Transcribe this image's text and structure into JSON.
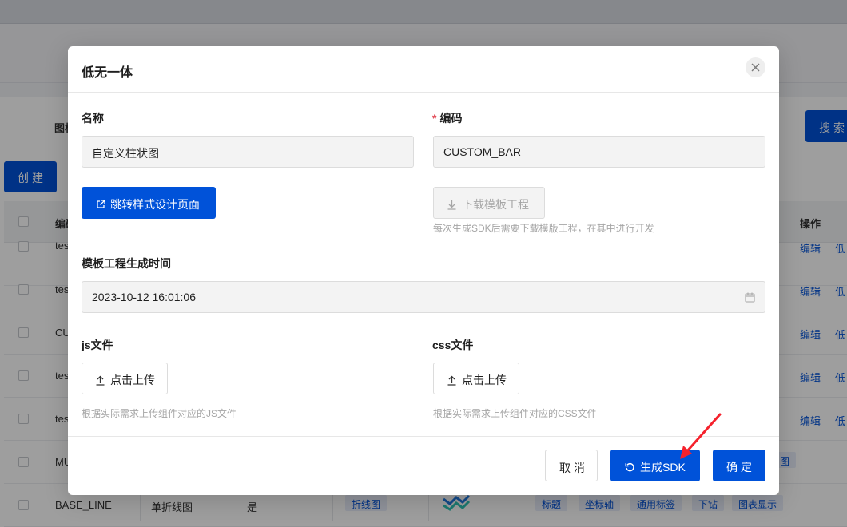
{
  "background": {
    "search_label": "图标",
    "search_button": "搜索",
    "create_button": "创建",
    "table_headers": {
      "code": "编码",
      "actions": "操作"
    },
    "rows": [
      {
        "code": "tes",
        "ops": [
          "编辑",
          "低"
        ]
      },
      {
        "code": "tes",
        "ops": [
          "编辑",
          "低"
        ]
      },
      {
        "code": "CU",
        "ops": [
          "编辑",
          "低"
        ]
      },
      {
        "code": "tes",
        "ops": [
          "编辑",
          "低"
        ]
      },
      {
        "code": "tes",
        "ops": [
          "编辑",
          "低"
        ]
      },
      {
        "code": "MU",
        "ops": []
      }
    ],
    "last_row": {
      "code": "BASE_LINE",
      "name": "单折线图",
      "flag": "是",
      "type_tag": "折线图",
      "tags": [
        "标题",
        "坐标轴",
        "通用标签",
        "下钻",
        "图表显示"
      ]
    },
    "row6_tag": "图"
  },
  "dialog": {
    "title": "低无一体",
    "name_label": "名称",
    "name_value": "自定义柱状图",
    "code_required_mark": "*",
    "code_label": "编码",
    "code_value": "CUSTOM_BAR",
    "style_design_button": "跳转样式设计页面",
    "download_template_button": "下载模板工程",
    "download_hint": "每次生成SDK后需要下载模版工程，在其中进行开发",
    "gen_time_label": "模板工程生成时间",
    "gen_time_value": "2023-10-12 16:01:06",
    "js_label": "js文件",
    "js_upload_button": "点击上传",
    "js_hint": "根据实际需求上传组件对应的JS文件",
    "css_label": "css文件",
    "css_upload_button": "点击上传",
    "css_hint": "根据实际需求上传组件对应的CSS文件",
    "cancel_button": "取 消",
    "generate_sdk_button": "生成SDK",
    "confirm_button": "确 定"
  },
  "colors": {
    "primary": "#0052d9",
    "annotation_arrow": "#f5222d"
  }
}
